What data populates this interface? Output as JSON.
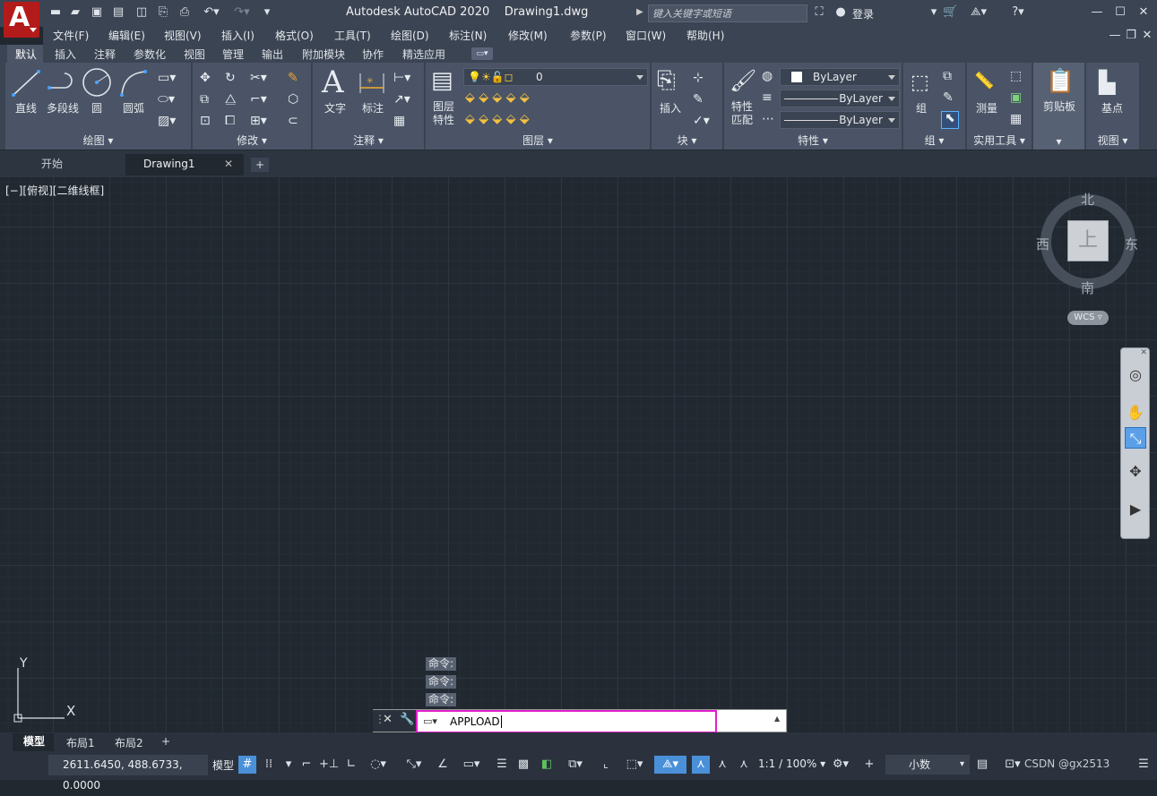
{
  "app": {
    "logo_letter": "A",
    "title": "Autodesk AutoCAD 2020",
    "document": "Drawing1.dwg",
    "search_placeholder": "键入关键字或短语",
    "login": "登录"
  },
  "menus": [
    "文件(F)",
    "编辑(E)",
    "视图(V)",
    "插入(I)",
    "格式(O)",
    "工具(T)",
    "绘图(D)",
    "标注(N)",
    "修改(M)",
    "参数(P)",
    "窗口(W)",
    "帮助(H)"
  ],
  "ribbon_tabs": [
    "默认",
    "插入",
    "注释",
    "参数化",
    "视图",
    "管理",
    "输出",
    "附加模块",
    "协作",
    "精选应用"
  ],
  "panels": {
    "draw": {
      "title": "绘图",
      "line": "直线",
      "polyline": "多段线",
      "circle": "圆",
      "arc": "圆弧"
    },
    "modify": {
      "title": "修改"
    },
    "annotation": {
      "title": "注释",
      "text": "文字",
      "dimension": "标注"
    },
    "layers": {
      "title": "图层",
      "layer_props_1": "图层",
      "layer_props_2": "特性",
      "current_layer": "0"
    },
    "block": {
      "title": "块",
      "insert": "插入"
    },
    "properties": {
      "title": "特性",
      "match_1": "特性",
      "match_2": "匹配",
      "color": "ByLayer",
      "linetype": "ByLayer",
      "lineweight": "ByLayer"
    },
    "groups": {
      "title": "组",
      "group": "组"
    },
    "utilities": {
      "title": "实用工具",
      "measure": "测量"
    },
    "clipboard": {
      "title": "剪贴板"
    },
    "view": {
      "title": "视图",
      "base": "基点"
    }
  },
  "file_tabs": {
    "start": "开始",
    "drawing": "Drawing1"
  },
  "viewport_label": "[−][俯视][二维线框]",
  "viewcube": {
    "north": "北",
    "south": "南",
    "west": "西",
    "east": "东",
    "face": "上",
    "wcs": "WCS"
  },
  "ucs": {
    "x": "X",
    "y": "Y"
  },
  "command": {
    "history": [
      "命令:",
      "命令:",
      "命令:"
    ],
    "input": "APPLOAD"
  },
  "layout_tabs": [
    "模型",
    "布局1",
    "布局2"
  ],
  "status": {
    "coords": "2611.6450, 488.6733, 0.0000",
    "model": "模型",
    "scale": "1:1 / 100%",
    "units": "小数",
    "watermark": "CSDN @gx2513"
  },
  "colors": {
    "accent_active": "#4a90d9",
    "cmd_highlight": "#e020c8"
  }
}
